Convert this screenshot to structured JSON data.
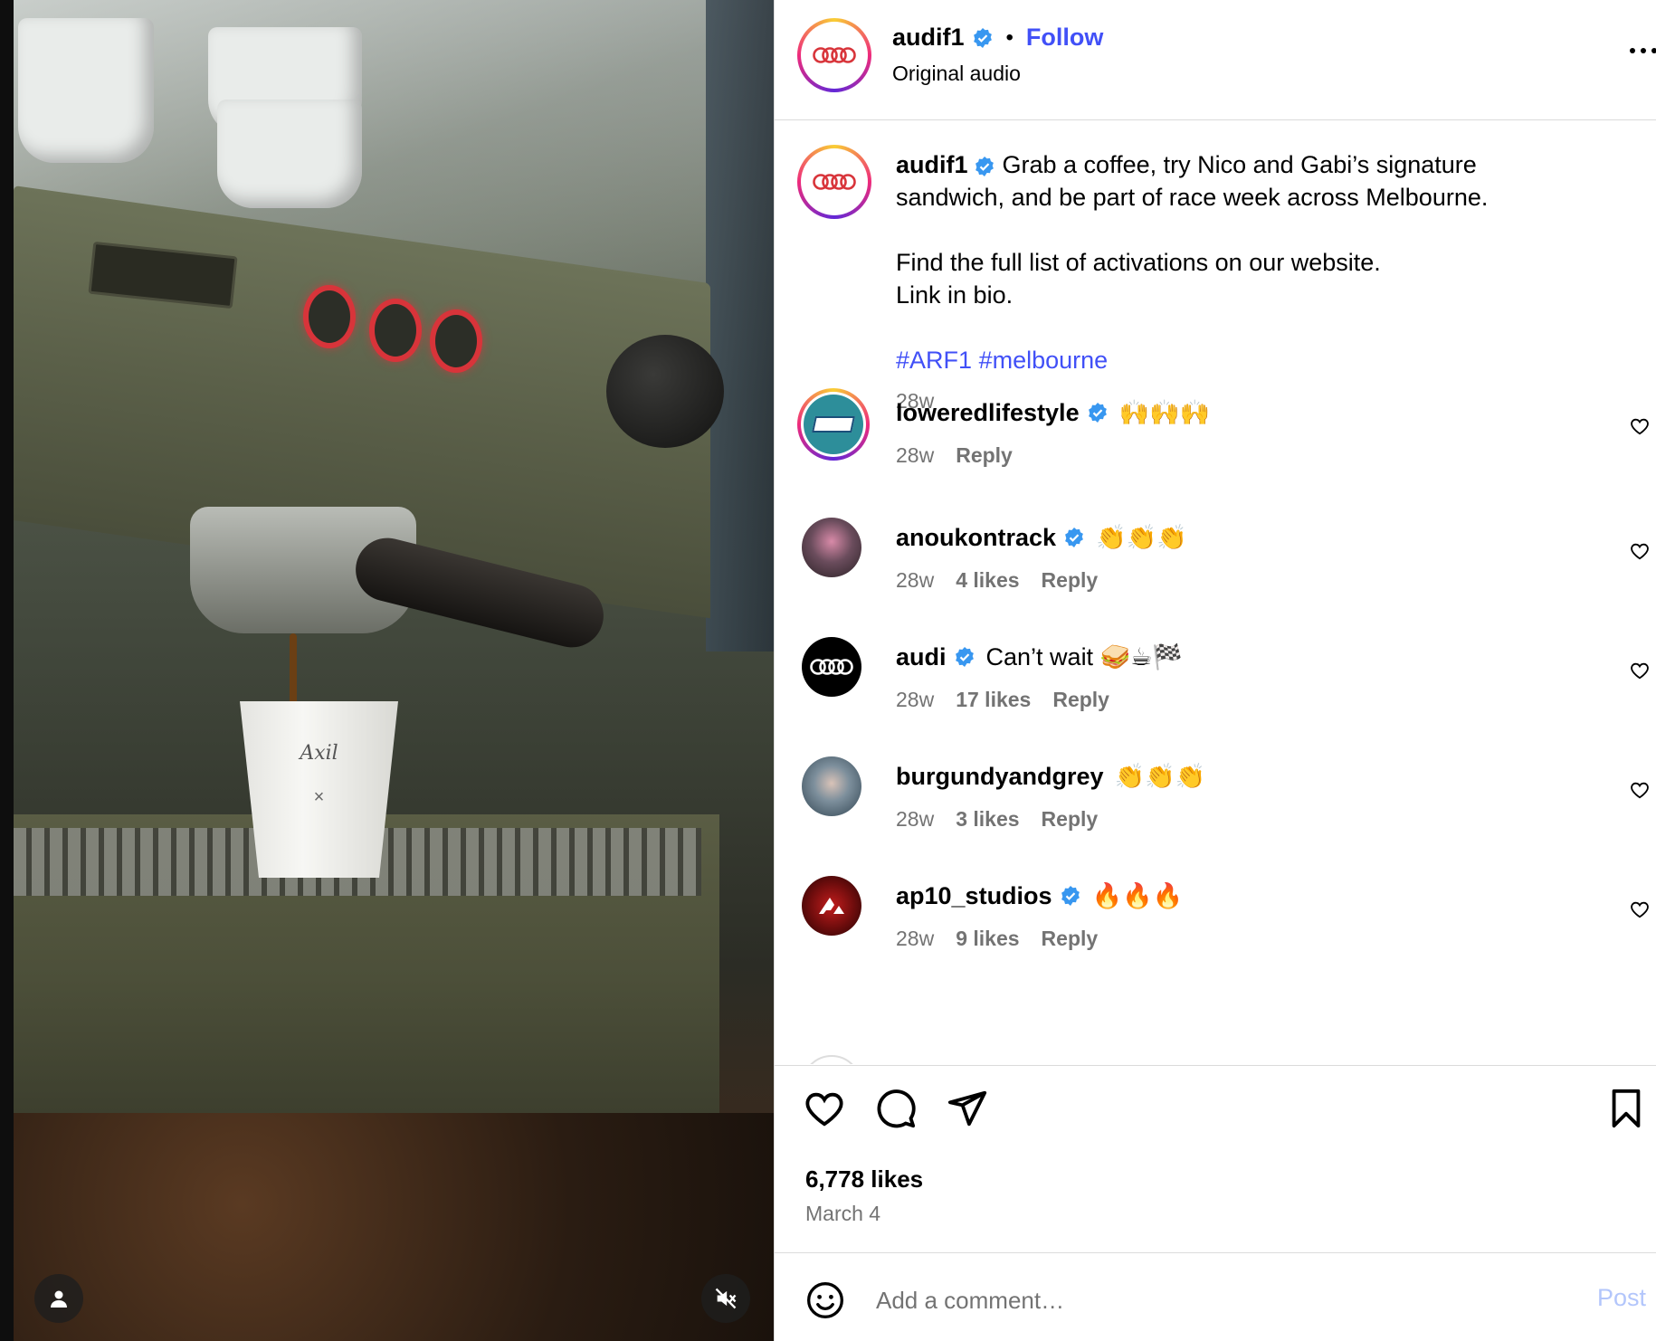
{
  "post": {
    "username": "audif1",
    "follow_label": "Follow",
    "audio_label": "Original audio",
    "more_icon": "more-options-icon",
    "caption_lines": [
      "Grab a coffee, try Nico and Gabi’s signature",
      "sandwich, and be part of race week across Melbourne."
    ],
    "caption_lines_2": [
      "Find the full list of activations on our website.",
      "Link in bio."
    ],
    "hashtags": [
      "#ARF1",
      "#melbourne"
    ],
    "caption_time": "28w",
    "likes_label": "6,778 likes",
    "date_label": "March 4"
  },
  "media": {
    "cup_brand": "Axil",
    "cup_x": "×"
  },
  "comments": [
    {
      "username": "loweredlifestyle",
      "text": "🙌🙌🙌",
      "time": "28w",
      "likes": "",
      "reply": "Reply",
      "avatar": "#2d8e9a"
    },
    {
      "username": "anoukontrack",
      "text": "👏👏👏",
      "time": "28w",
      "likes": "4 likes",
      "reply": "Reply",
      "avatar": "#c77a9a"
    },
    {
      "username": "audi",
      "text": "Can’t wait 🥪☕🏁",
      "time": "28w",
      "likes": "17 likes",
      "reply": "Reply",
      "avatar": "#000000"
    },
    {
      "username": "burgundyandgrey",
      "text": "👏👏👏",
      "time": "28w",
      "likes": "3 likes",
      "reply": "Reply",
      "avatar": "#5a6f80"
    },
    {
      "username": "ap10_studios",
      "text": "🔥🔥🔥",
      "time": "28w",
      "likes": "9 likes",
      "reply": "Reply",
      "avatar": "#8a1414"
    }
  ],
  "comment_input": {
    "placeholder": "Add a comment…",
    "post_label": "Post"
  },
  "colors": {
    "link_blue": "#4150f7",
    "verified_blue": "#3897f0",
    "muted": "#737373",
    "audi_red": "#d8343a"
  }
}
